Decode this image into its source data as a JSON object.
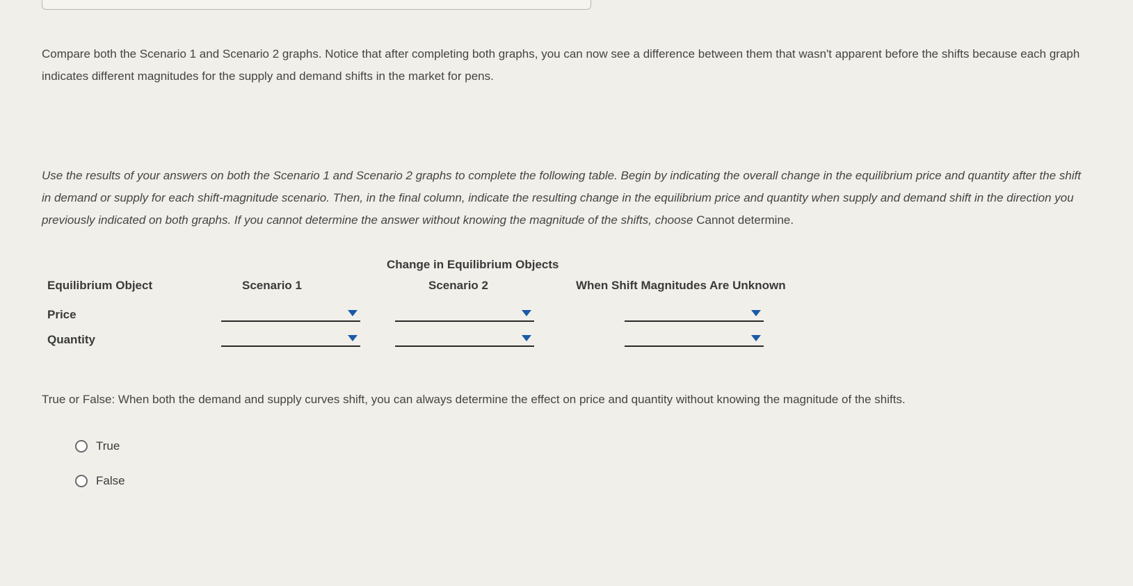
{
  "paragraph1": "Compare both the Scenario 1 and Scenario 2 graphs. Notice that after completing both graphs, you can now see a difference between them that wasn't apparent before the shifts because each graph indicates different magnitudes for the supply and demand shifts in the market for pens.",
  "paragraph2_italic": "Use the results of your answers on both the Scenario 1 and Scenario 2 graphs to complete the following table. Begin by indicating the overall change in the equilibrium price and quantity after the shift in demand or supply for each shift-magnitude scenario. Then, in the final column, indicate the resulting change in the equilibrium price and quantity when supply and demand shift in the direction you previously indicated on both graphs. If you cannot determine the answer without knowing the magnitude of the shifts, choose ",
  "paragraph2_tail": "Cannot determine.",
  "table": {
    "super_header": "Change in Equilibrium Objects",
    "col_headers": [
      "Equilibrium Object",
      "Scenario 1",
      "Scenario 2",
      "When Shift Magnitudes Are Unknown"
    ],
    "rows": [
      "Price",
      "Quantity"
    ]
  },
  "tf_question": "True or False: When both the demand and supply curves shift, you can always determine the effect on price and quantity without knowing the magnitude of the shifts.",
  "radio_options": {
    "true_label": "True",
    "false_label": "False"
  }
}
